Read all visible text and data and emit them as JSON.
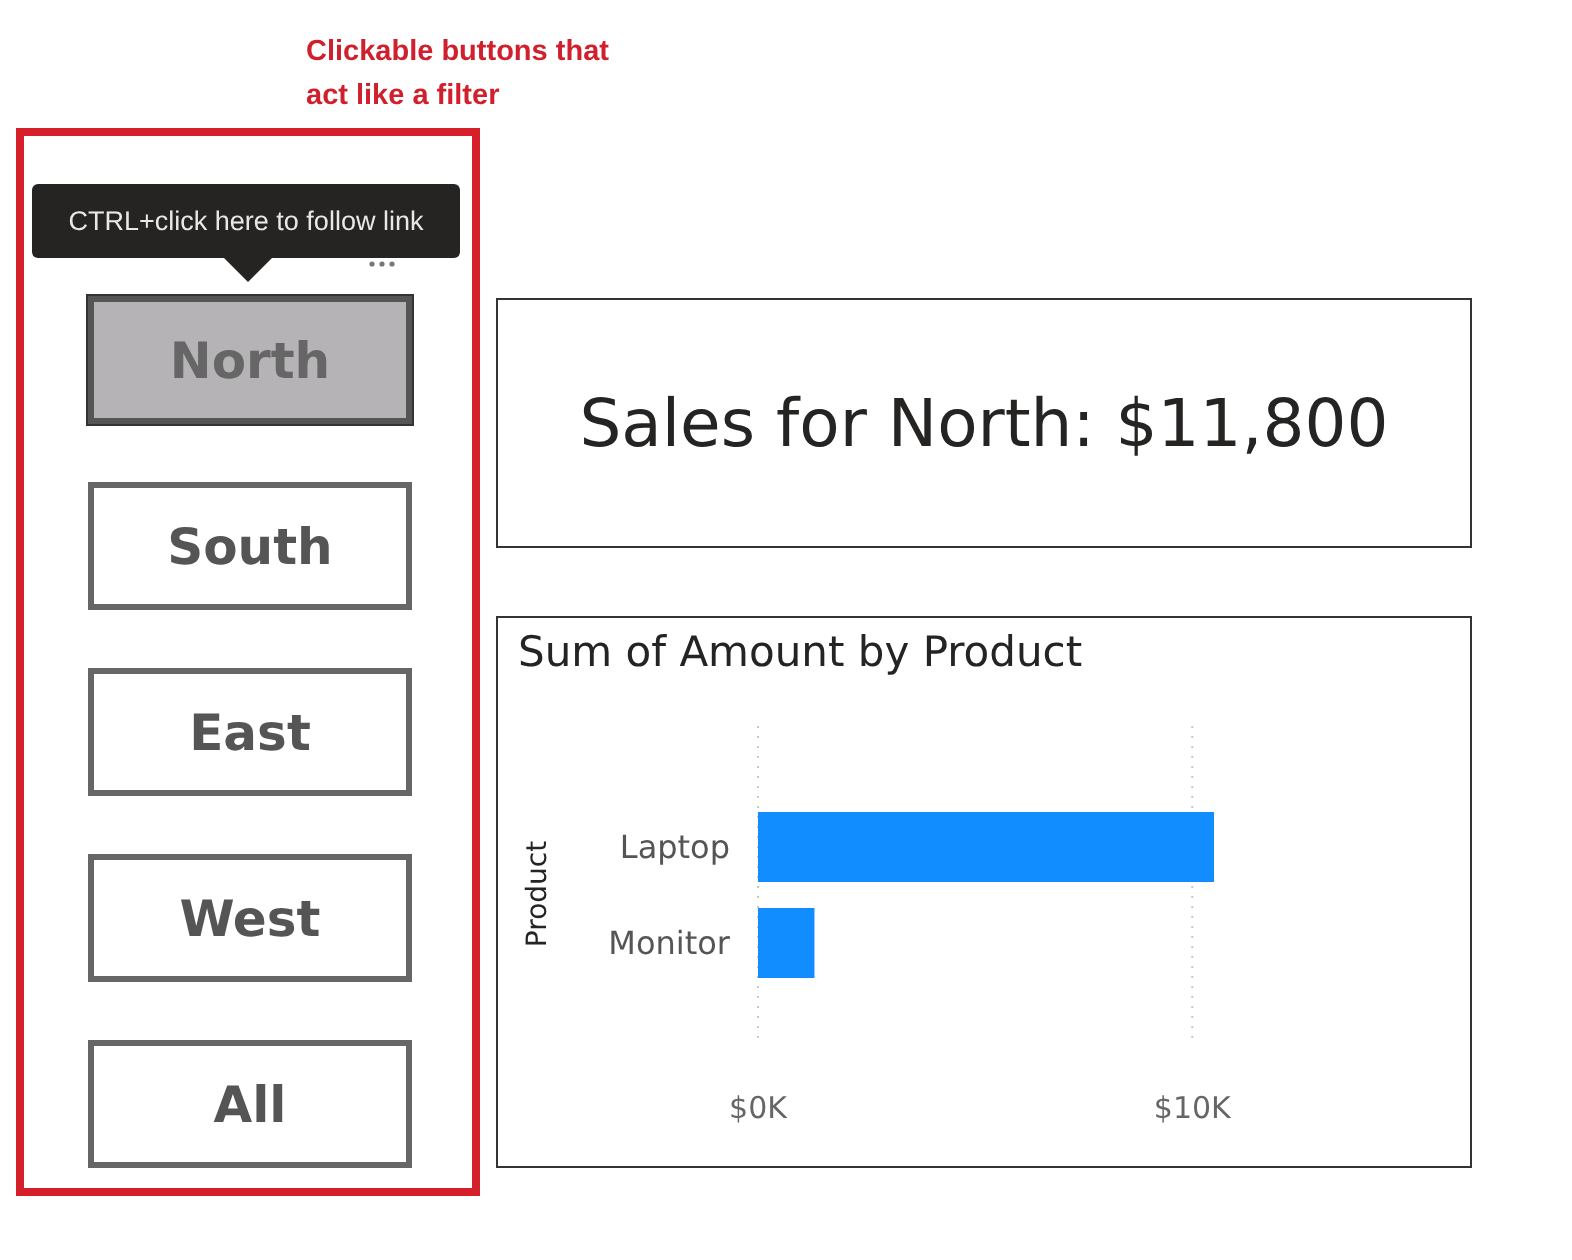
{
  "annotation": "Clickable buttons that act like a filter",
  "tooltip": "CTRL+click here to follow link",
  "buttons": [
    {
      "label": "North",
      "selected": true
    },
    {
      "label": "South",
      "selected": false
    },
    {
      "label": "East",
      "selected": false
    },
    {
      "label": "West",
      "selected": false
    },
    {
      "label": "All",
      "selected": false
    }
  ],
  "card": {
    "text": "Sales for North: $11,800"
  },
  "chart": {
    "chart_data": {
      "type": "bar",
      "orientation": "horizontal",
      "title": "Sum of Amount by Product",
      "ylabel": "Product",
      "categories": [
        "Laptop",
        "Monitor"
      ],
      "series": [
        {
          "color": "#118dff",
          "values": [
            10500,
            1300
          ]
        }
      ],
      "xlim": [
        0,
        10500
      ],
      "xticks": [
        {
          "value": 0,
          "label": "$0K"
        },
        {
          "value": 10000,
          "label": "$10K"
        }
      ]
    }
  }
}
